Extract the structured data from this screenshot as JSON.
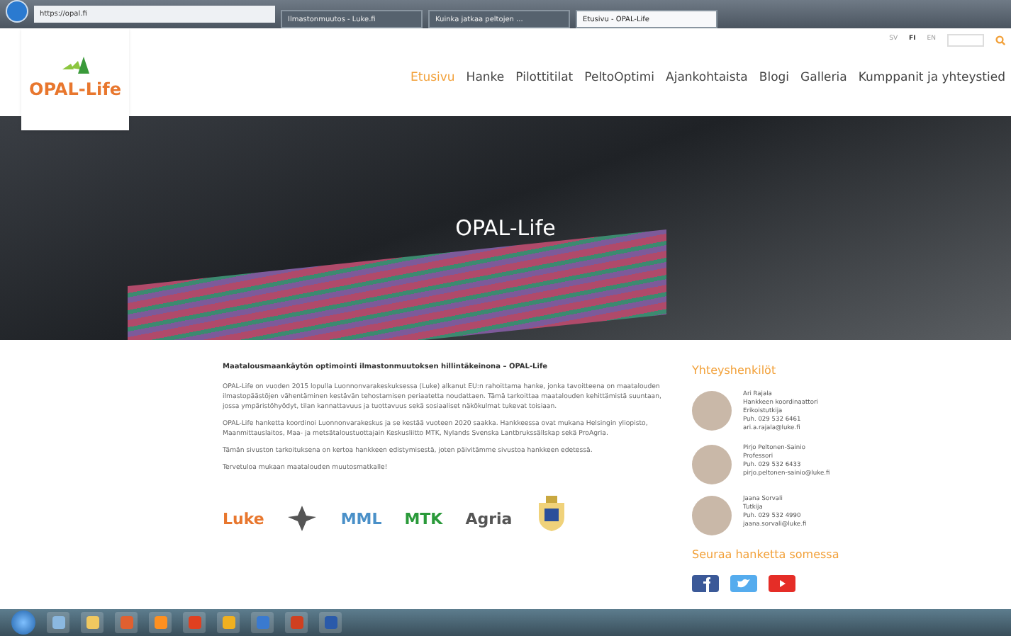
{
  "browser": {
    "address": "https://opal.fi",
    "tabs": [
      {
        "label": "Ilmastonmuutos - Luke.fi",
        "selected": false
      },
      {
        "label": "Kuinka jatkaa peltojen ...",
        "selected": false
      },
      {
        "label": "Etusivu - OPAL-Life",
        "selected": true
      }
    ]
  },
  "site": {
    "logo": "OPAL-Life",
    "languages": [
      {
        "label": "SV",
        "selected": false
      },
      {
        "label": "FI",
        "selected": true
      },
      {
        "label": "EN",
        "selected": false
      }
    ],
    "nav": [
      {
        "label": "Etusivu",
        "selected": true
      },
      {
        "label": "Hanke",
        "selected": false
      },
      {
        "label": "Pilottitilat",
        "selected": false
      },
      {
        "label": "PeltoOptimi",
        "selected": false
      },
      {
        "label": "Ajankohtaista",
        "selected": false
      },
      {
        "label": "Blogi",
        "selected": false
      },
      {
        "label": "Galleria",
        "selected": false
      },
      {
        "label": "Kumppanit ja yhteystied",
        "selected": false
      }
    ]
  },
  "hero": {
    "title": "OPAL-Life"
  },
  "article": {
    "heading": "Maatalousmaankäytön optimointi ilmastonmuutoksen hillintäkeinona – OPAL-Life",
    "paragraphs": [
      "OPAL-Life on vuoden 2015 lopulla Luonnonvarakeskuksessa (Luke) alkanut EU:n rahoittama hanke, jonka tavoitteena on maatalouden ilmastopäästöjen vähentäminen kestävän tehostamisen periaatetta noudattaen. Tämä tarkoittaa maatalouden kehittämistä suuntaan, jossa ympäristöhyödyt, tilan kannattavuus ja tuottavuus sekä sosiaaliset näkökulmat tukevat toisiaan.",
      "OPAL-Life hanketta koordinoi Luonnonvarakeskus ja se kestää vuoteen 2020 saakka. Hankkeessa ovat mukana Helsingin yliopisto, Maanmittauslaitos, Maa- ja metsätaloustuottajain Keskusliitto MTK, Nylands Svenska Lantbrukssällskap sekä ProAgria.",
      "Tämän sivuston tarkoituksena on kertoa hankkeen edistymisestä, joten päivitämme sivustoa hankkeen edetessä.",
      "Tervetuloa mukaan maatalouden muutosmatkalle!"
    ]
  },
  "partners": [
    {
      "kind": "wordmark",
      "label": "Luke",
      "color": "#e8772e"
    },
    {
      "kind": "emblem"
    },
    {
      "kind": "wordmark",
      "label": "MML",
      "color": "#4a90c8"
    },
    {
      "kind": "wordmark",
      "label": "MTK",
      "color": "#2a9a3a"
    },
    {
      "kind": "wordmark",
      "label": "Agria",
      "color": "#555555"
    },
    {
      "kind": "crest"
    }
  ],
  "contacts": {
    "title": "Yhteyshenkilöt",
    "people": [
      {
        "lines": [
          "Ari Rajala",
          "Hankkeen koordinaattori",
          "Erikoistutkija",
          "Puh. 029 532 6461",
          "ari.a.rajala@luke.fi"
        ]
      },
      {
        "lines": [
          "Pirjo Peltonen-Sainio",
          "Professori",
          "Puh. 029 532 6433",
          "pirjo.peltonen-sainio@luke.fi"
        ]
      },
      {
        "lines": [
          "Jaana Sorvali",
          "Tutkija",
          "Puh. 029 532 4990",
          "jaana.sorvali@luke.fi"
        ]
      }
    ]
  },
  "social": {
    "title": "Seuraa hanketta somessa",
    "links": [
      {
        "kind": "facebook"
      },
      {
        "kind": "twitter"
      },
      {
        "kind": "youtube"
      }
    ]
  }
}
